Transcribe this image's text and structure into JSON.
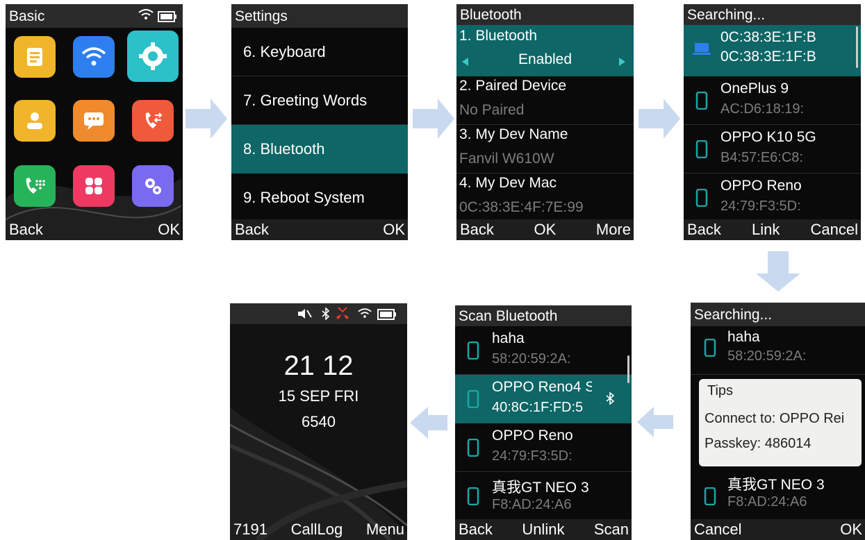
{
  "screen1": {
    "title": "Basic",
    "softkeys": {
      "left": "Back",
      "right": "OK"
    },
    "apps": [
      {
        "icon": "notes-icon",
        "color": "#f1b52c"
      },
      {
        "icon": "wifi-icon",
        "color": "#2d7ff0"
      },
      {
        "icon": "settings-icon",
        "color": "#2cc0c9"
      },
      {
        "icon": "contacts-icon",
        "color": "#f1b52c"
      },
      {
        "icon": "messages-icon",
        "color": "#f08a2c"
      },
      {
        "icon": "call-history-icon",
        "color": "#f05a3a"
      },
      {
        "icon": "dialer-icon",
        "color": "#27b35a"
      },
      {
        "icon": "apps-icon",
        "color": "#ee3a62"
      },
      {
        "icon": "advanced-settings-icon",
        "color": "#7a6af0"
      }
    ]
  },
  "screen2": {
    "title": "Settings",
    "items": [
      "6. Keyboard",
      "7. Greeting Words",
      "8. Bluetooth",
      "9. Reboot System"
    ],
    "softkeys": {
      "left": "Back",
      "right": "OK"
    }
  },
  "screen3": {
    "title": "Bluetooth",
    "rows": [
      {
        "label": "1. Bluetooth",
        "value": "Enabled"
      },
      {
        "label": "2. Paired Device",
        "value": "No Paired"
      },
      {
        "label": "3. My Dev Name",
        "value": "Fanvil W610W"
      },
      {
        "label": "4. My Dev Mac",
        "value": "0C:38:3E:4F:7E:99"
      }
    ],
    "softkeys": {
      "left": "Back",
      "center": "OK",
      "right": "More"
    }
  },
  "screen4": {
    "title": "Searching...",
    "devices": [
      {
        "name": "0C:38:3E:1F:B",
        "mac": "0C:38:3E:1F:B",
        "icon": "laptop-icon"
      },
      {
        "name": "OnePlus 9",
        "mac": "AC:D6:18:19:",
        "icon": "phone-icon"
      },
      {
        "name": "OPPO K10 5G",
        "mac": "B4:57:E6:C8:",
        "icon": "phone-icon"
      },
      {
        "name": "OPPO Reno",
        "mac": "24:79:F3:5D:",
        "icon": "phone-icon"
      }
    ],
    "softkeys": {
      "left": "Back",
      "center": "Link",
      "right": "Cancel"
    }
  },
  "screen5": {
    "title": "Searching...",
    "devices": [
      {
        "name": "haha",
        "mac": "58:20:59:2A:"
      },
      {
        "name": "真我GT NEO 3",
        "mac": "F8:AD:24:A6"
      }
    ],
    "tips": {
      "title": "Tips",
      "line1": "Connect to: OPPO Rei",
      "line2": "Passkey: 486014"
    },
    "softkeys": {
      "left": "Cancel",
      "right": "OK"
    }
  },
  "screen6": {
    "title": "Scan Bluetooth",
    "devices": [
      {
        "name": "haha",
        "mac": "58:20:59:2A:"
      },
      {
        "name": "OPPO Reno4 S",
        "mac": "40:8C:1F:FD:5"
      },
      {
        "name": "OPPO Reno",
        "mac": "24:79:F3:5D:"
      },
      {
        "name": "真我GT NEO 3",
        "mac": "F8:AD:24:A6"
      }
    ],
    "softkeys": {
      "left": "Back",
      "center": "Unlink",
      "right": "Scan"
    }
  },
  "screen7": {
    "time": "21 12",
    "date": "15 SEP FRI",
    "extension": "6540",
    "softkeys": {
      "left": "7191",
      "center": "CallLog",
      "right": "Menu"
    }
  },
  "colors": {
    "accent": "#0e6666",
    "arrow": "#c9d9ef"
  }
}
